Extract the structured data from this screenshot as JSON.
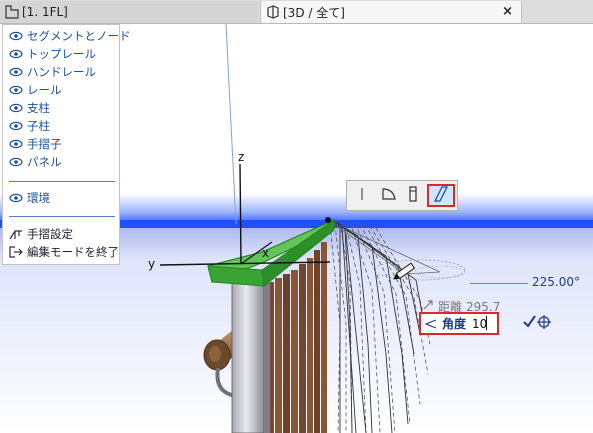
{
  "tabs": [
    {
      "label": "[1. 1FL]",
      "icon": "floor-plan-icon"
    },
    {
      "label": "[3D / 全て]",
      "icon": "3d-view-icon",
      "close": "×"
    }
  ],
  "panel": {
    "items": [
      {
        "label": "セグメントとノード",
        "icon": "eye-icon"
      },
      {
        "label": "トップレール",
        "icon": "eye-icon"
      },
      {
        "label": "ハンドレール",
        "icon": "eye-icon"
      },
      {
        "label": "レール",
        "icon": "eye-icon"
      },
      {
        "label": "支柱",
        "icon": "eye-icon"
      },
      {
        "label": "子柱",
        "icon": "eye-icon"
      },
      {
        "label": "手摺子",
        "icon": "eye-icon"
      },
      {
        "label": "パネル",
        "icon": "eye-icon"
      }
    ],
    "env": {
      "label": "環境",
      "icon": "eye-icon"
    },
    "settings": {
      "label": "手摺設定",
      "icon": "railing-settings-icon"
    },
    "exit": {
      "label": "編集モードを終了",
      "icon": "exit-icon"
    }
  },
  "axes": {
    "z": "z",
    "y": "y",
    "x": "x"
  },
  "tracker": {
    "angle_readout": "225.00°",
    "distance_label": "距離",
    "distance_value": "295.7",
    "angle_label": "角度",
    "angle_value": "10"
  },
  "colors": {
    "panel_text": "#1e50a0",
    "highlight": "#e0262b",
    "active_fill": "#cfe6f7",
    "railing_top": "#3fa83a",
    "sky_blue": "#1f4fff"
  }
}
